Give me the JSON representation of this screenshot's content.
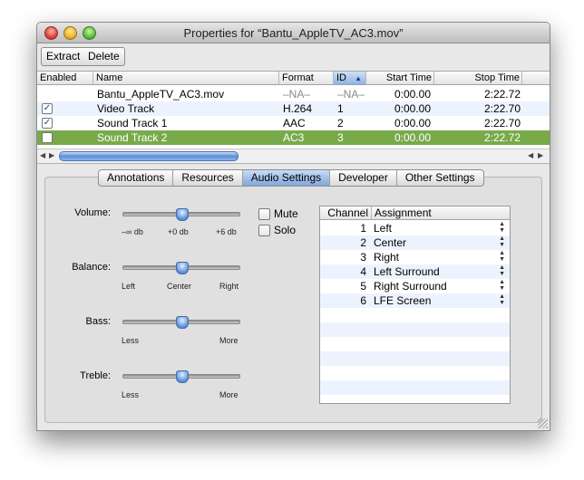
{
  "window": {
    "title": "Properties for “Bantu_AppleTV_AC3.mov”"
  },
  "toolbar": {
    "extract_label": "Extract",
    "delete_label": "Delete"
  },
  "tracks": {
    "columns": [
      "Enabled",
      "Name",
      "Format",
      "ID",
      "Start Time",
      "Stop Time"
    ],
    "rows": [
      {
        "enabled": null,
        "name": "Bantu_AppleTV_AC3.mov",
        "format": "–NA–",
        "id": "–NA–",
        "start": "0:00.00",
        "stop": "2:22.72"
      },
      {
        "enabled": true,
        "name": "Video Track",
        "format": "H.264",
        "id": "1",
        "start": "0:00.00",
        "stop": "2:22.70"
      },
      {
        "enabled": true,
        "name": "Sound Track 1",
        "format": "AAC",
        "id": "2",
        "start": "0:00.00",
        "stop": "2:22.70"
      },
      {
        "enabled": false,
        "name": "Sound Track 2",
        "format": "AC3",
        "id": "3",
        "start": "0:00.00",
        "stop": "2:22.72"
      }
    ]
  },
  "tabs": [
    "Annotations",
    "Resources",
    "Audio Settings",
    "Developer",
    "Other Settings"
  ],
  "active_tab": "Audio Settings",
  "audio": {
    "volume": {
      "label": "Volume:",
      "ticks": [
        "–∞ db",
        "+0 db",
        "+6 db"
      ]
    },
    "balance": {
      "label": "Balance:",
      "ticks": [
        "Left",
        "Center",
        "Right"
      ]
    },
    "bass": {
      "label": "Bass:",
      "ticks": [
        "Less",
        "More"
      ]
    },
    "treble": {
      "label": "Treble:",
      "ticks": [
        "Less",
        "More"
      ]
    },
    "mute_label": "Mute",
    "solo_label": "Solo"
  },
  "channels": {
    "columns": [
      "Channel",
      "Assignment"
    ],
    "rows": [
      {
        "channel": "1",
        "assignment": "Left"
      },
      {
        "channel": "2",
        "assignment": "Center"
      },
      {
        "channel": "3",
        "assignment": "Right"
      },
      {
        "channel": "4",
        "assignment": "Left Surround"
      },
      {
        "channel": "5",
        "assignment": "Right Surround"
      },
      {
        "channel": "6",
        "assignment": "LFE Screen"
      }
    ]
  }
}
